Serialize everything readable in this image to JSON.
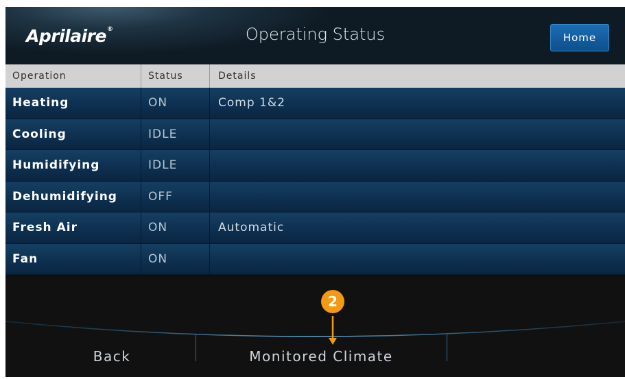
{
  "header": {
    "logo_text": "Aprilaire",
    "logo_mark": "®",
    "title": "Operating Status",
    "home_label": "Home"
  },
  "table": {
    "columns": [
      "Operation",
      "Status",
      "Details"
    ],
    "rows": [
      {
        "operation": "Heating",
        "status": "ON",
        "details": "Comp 1&2"
      },
      {
        "operation": "Cooling",
        "status": "IDLE",
        "details": ""
      },
      {
        "operation": "Humidifying",
        "status": "IDLE",
        "details": ""
      },
      {
        "operation": "Dehumidifying",
        "status": "OFF",
        "details": ""
      },
      {
        "operation": "Fresh Air",
        "status": "ON",
        "details": "Automatic"
      },
      {
        "operation": "Fan",
        "status": "ON",
        "details": ""
      }
    ]
  },
  "footer": {
    "back_label": "Back",
    "monitored_label": "Monitored Climate"
  },
  "annotation": {
    "number": "2",
    "color": "#f29a13"
  },
  "colors": {
    "home_button": "#1d6db3",
    "row_background": "#0e3051",
    "header_row": "#d2d2d2"
  }
}
